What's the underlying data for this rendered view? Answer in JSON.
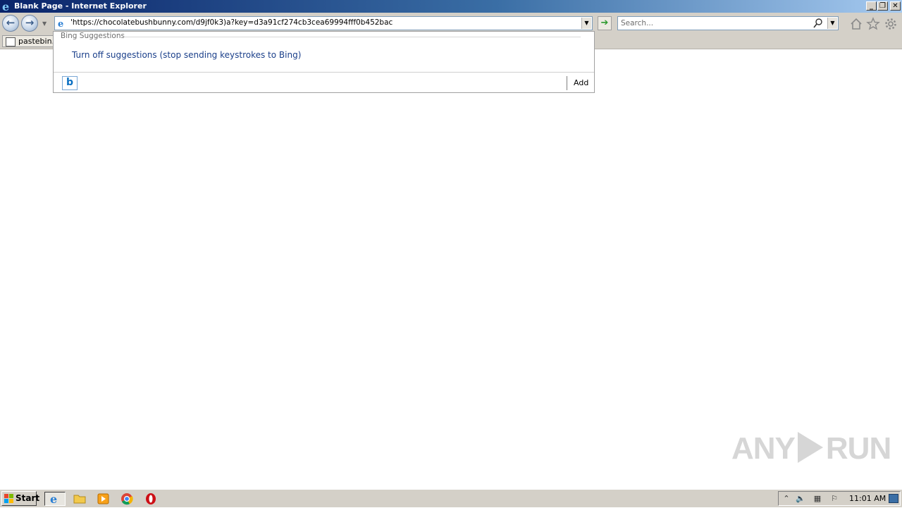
{
  "window": {
    "title": "Blank Page - Internet Explorer",
    "minimize_glyph": "_",
    "restore_glyph": "❐",
    "close_glyph": "✕"
  },
  "navigation": {
    "back_glyph": "←",
    "forward_glyph": "→",
    "address_value": "'https://chocolatebushbunny.com/d9jf0k3)a?key=d3a91cf274cb3cea69994fff0b452bac",
    "go_glyph": "➔",
    "search_placeholder": "Search...",
    "home_icon": "home-icon",
    "favorites_icon": "star-icon",
    "tools_icon": "gear-icon"
  },
  "favorites_bar": {
    "items": [
      {
        "label": "pastebin.c"
      }
    ]
  },
  "suggestions": {
    "header": "Bing Suggestions",
    "turn_off_label": "Turn off suggestions (stop sending keystrokes to Bing)",
    "provider_icon": "bing-icon",
    "add_label": "Add"
  },
  "watermark": {
    "left": "ANY",
    "right": "RUN"
  },
  "taskbar": {
    "start_label": "Start",
    "pinned": [
      "ie-icon",
      "folder-icon",
      "media-player-icon",
      "chrome-icon",
      "opera-icon"
    ],
    "clock": "11:01 AM"
  },
  "colors": {
    "title_gradient_start": "#0a246a",
    "title_gradient_end": "#a6caf0",
    "chrome_gray": "#d4d0c8",
    "link_blue": "#1a3f8a"
  }
}
